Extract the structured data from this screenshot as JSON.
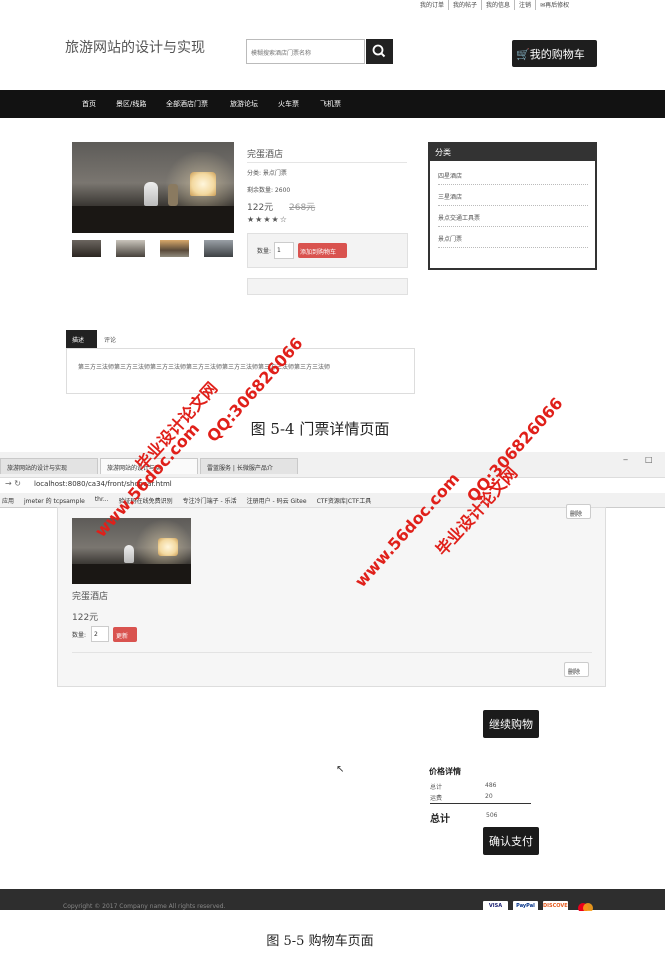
{
  "fig1": {
    "topbar": [
      "我的订单",
      "我的帖子",
      "我的信息",
      "注销",
      "✉再后修权"
    ],
    "site_title": "旅游网站的设计与实现",
    "search_placeholder": "模糊搜索酒店门票名称",
    "cart_button": "我的购物车",
    "nav": [
      "首页",
      "景区/线路",
      "全部酒店门票",
      "旅游论坛",
      "火车票",
      "飞机票"
    ],
    "product": {
      "name": "完蛋酒店",
      "category": "分类: 景点门票",
      "stock": "剩余数量: 2600",
      "price": "122元",
      "old_price": "268元",
      "stars": "★★★★☆",
      "qty_label": "数量:",
      "qty_value": "1",
      "add_to_cart": "添加到购物车"
    },
    "category_panel": {
      "title": "分类",
      "items": [
        "四星酒店",
        "三星酒店",
        "景点交通工具票",
        "景点门票"
      ]
    },
    "tabs": {
      "desc": "描述",
      "review": "评论"
    },
    "desc_text": "第三方三法师第三方三法师第三方三法师第三方三法师第三方三法师第三方三法师第三方三法师",
    "caption": "图 5-4 门票详情页面"
  },
  "fig2": {
    "tabs": [
      "旅游网站的设计与实现",
      "旅游网站的设计与实",
      "雷蓝服务 | 长微服产品介"
    ],
    "window_controls": [
      "‒",
      "□"
    ],
    "url": "localhost:8080/ca34/front/shopcar.html",
    "bookmarks": [
      "应用",
      "jmeter 的 tcpsample",
      "thr...",
      "验证码在线免费识别",
      "专注冷门端子 - 乐活",
      "注册用户 - 码云 Gitee",
      "CTF资源库|CTF工具"
    ],
    "delete_label": "删除",
    "item": {
      "name": "完蛋酒店",
      "price": "122元",
      "qty_label": "数量:",
      "qty_value": "2",
      "update": "更新"
    },
    "continue_button": "继续购物",
    "price_details": {
      "title": "价格详情",
      "rows": [
        {
          "label": "总计",
          "value": "486"
        },
        {
          "label": "运费",
          "value": "20"
        }
      ],
      "total_label": "总计",
      "total_value": "506"
    },
    "pay_button": "确认支付",
    "footer_copy": "Copyright © 2017 Company name All rights reserved.",
    "payments": [
      "VISA",
      "PayPal",
      "DISCOVER",
      "MC"
    ],
    "caption": "图 5-5 购物车页面"
  },
  "watermarks": {
    "site": "www.56doc.com",
    "qq": "QQ:306826066",
    "name": "毕业设计论文网"
  },
  "colors": {
    "accent_red": "#d9534f",
    "dark": "#1b1b1b",
    "watermark": "#e0201a"
  }
}
